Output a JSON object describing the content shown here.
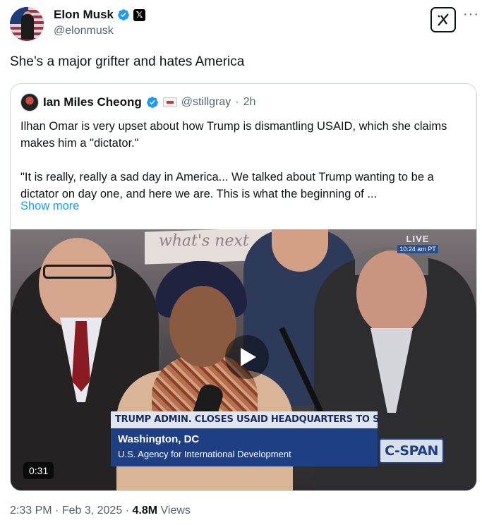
{
  "author": {
    "display_name": "Elon Musk",
    "handle": "@elonmusk",
    "verified_icon": "verified-badge-icon",
    "affiliate_icon": "x-logo-icon"
  },
  "header_actions": {
    "grok_icon": "grok-icon",
    "more_icon": "more-icon",
    "more_glyph": "···"
  },
  "tweet": {
    "text": "She’s a major grifter and hates America"
  },
  "quote": {
    "display_name": "Ian Miles Cheong",
    "handle": "@stillgray",
    "separator": "·",
    "time": "2h",
    "paragraph1": "Ilhan Omar is very upset about how Trump is dismantling USAID, which she claims makes him a \"dictator.\"",
    "paragraph2": "\"It is really, really a sad day in America... We talked about Trump wanting to be a dictator on day one, and here we are. This is what the beginning of ...",
    "show_more": "Show more"
  },
  "video": {
    "sign_text": "what's next",
    "live_label": "LIVE",
    "live_time": "10:24 am PT",
    "headline": "TRUMP ADMIN. CLOSES USAID HEADQUARTERS TO STAFF",
    "location": "Washington, DC",
    "agency": "U.S. Agency for International Development",
    "network_logo": "C-SPAN",
    "duration": "0:31",
    "play_icon": "play-icon"
  },
  "meta": {
    "time": "2:33 PM",
    "separator1": "·",
    "date": "Feb 3, 2025",
    "separator2": "·",
    "views_count": "4.8M",
    "views_label": "Views"
  },
  "colors": {
    "link": "#1d9bf0",
    "secondary_text": "#536471",
    "verified": "#1d9bf0",
    "cspan_blue": "#1e3f84"
  }
}
